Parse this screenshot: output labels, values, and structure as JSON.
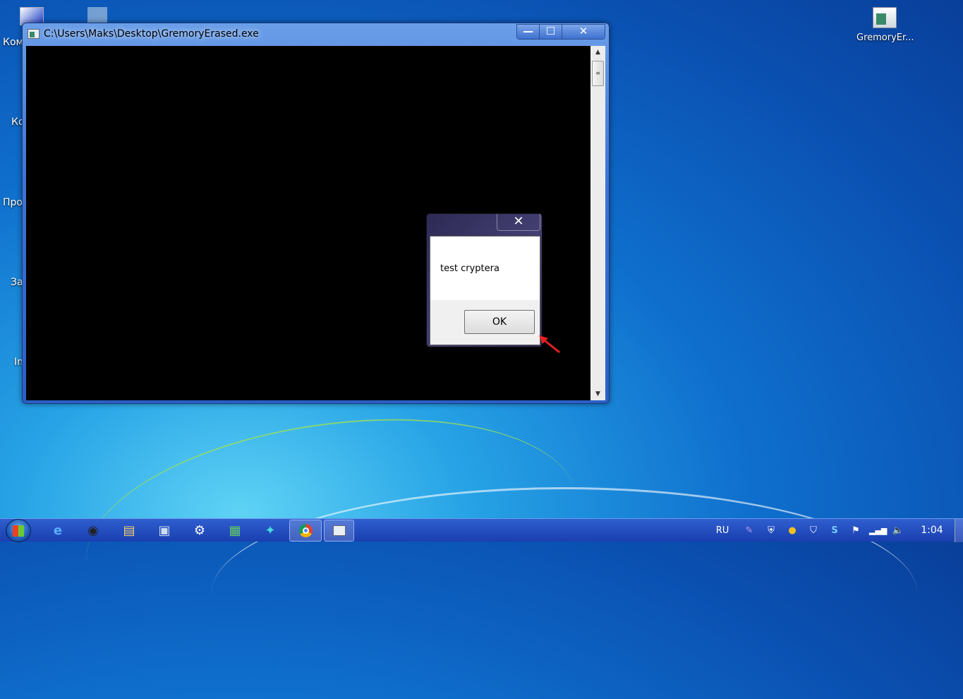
{
  "desktop": {
    "left_icons": [
      "Ком",
      "Ко",
      "Про",
      "За",
      "In"
    ],
    "right_icon_label": "GremoryEr..."
  },
  "console_window": {
    "title": "C:\\Users\\Maks\\Desktop\\GremoryErased.exe",
    "minimize": "—",
    "maximize": "☐",
    "close": "✕"
  },
  "message_box": {
    "message": "test cryptera",
    "ok_label": "OK",
    "close": "✕"
  },
  "taskbar": {
    "pinned": [
      {
        "name": "internet-explorer-icon",
        "glyph": "e"
      },
      {
        "name": "media-icon",
        "glyph": "◉"
      },
      {
        "name": "explorer-icon",
        "glyph": "▤"
      },
      {
        "name": "network-icon",
        "glyph": "▣"
      },
      {
        "name": "settings-icon",
        "glyph": "⚙"
      },
      {
        "name": "terminal-icon",
        "glyph": "▦"
      },
      {
        "name": "puzzle-icon",
        "glyph": "✦"
      }
    ],
    "tray": {
      "language": "RU",
      "clock": "1:04"
    }
  },
  "colors": {
    "accent": "#e52020"
  }
}
